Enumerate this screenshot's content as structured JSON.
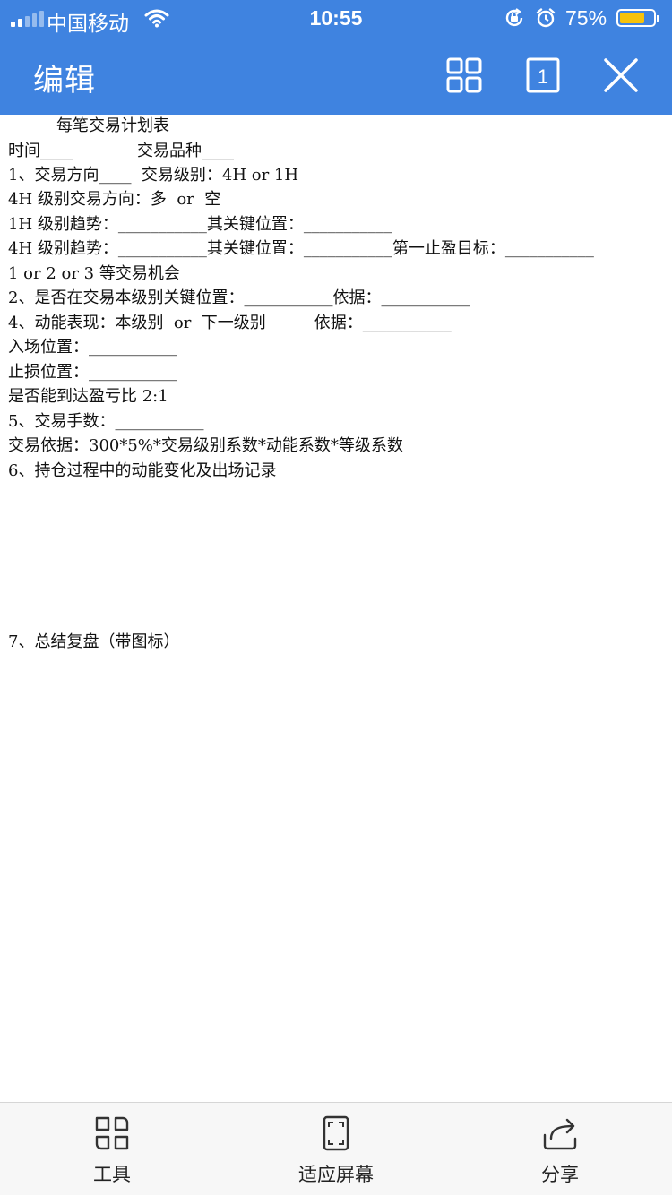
{
  "status_bar": {
    "carrier": "中国移动",
    "time": "10:55",
    "battery_percent": "75%",
    "battery_level": 0.75,
    "icons": [
      "signal-icon",
      "wifi-icon",
      "orientation-lock-icon",
      "alarm-icon",
      "battery-icon"
    ],
    "colors": {
      "bar": "#3f83e0",
      "battery_fill": "#f7c20a"
    }
  },
  "nav": {
    "title": "编辑",
    "page_number": "1",
    "icons": [
      "grid-icon",
      "page-number-icon",
      "close-icon"
    ]
  },
  "document": {
    "lines": [
      "　　　每笔交易计划表",
      "时间____　　　　交易品种____",
      "1、交易方向____  交易级别：4H or 1H",
      "4H 级别交易方向：多  or  空",
      "1H 级别趋势：___________其关键位置：___________",
      "4H 级别趋势：___________其关键位置：___________第一止盈目标：___________",
      "1 or 2 or 3 等交易机会",
      "2、是否在交易本级别关键位置：___________依据：___________",
      "4、动能表现：本级别  or  下一级别　　　依据：___________",
      "入场位置：___________",
      "止损位置：___________",
      "是否能到达盈亏比 2:1",
      "5、交易手数：___________",
      "交易依据：300*5%*交易级别系数*动能系数*等级系数",
      "6、持仓过程中的动能变化及出场记录",
      "7、总结复盘（带图标）"
    ]
  },
  "toolbar": {
    "tools": [
      "工具",
      "适应屏幕",
      "分享"
    ],
    "icons": [
      "tools-icon",
      "fit-screen-icon",
      "share-icon"
    ]
  }
}
